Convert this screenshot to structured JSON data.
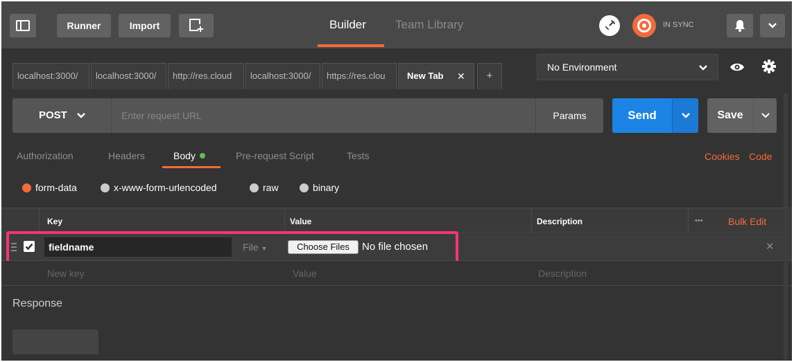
{
  "header": {
    "runner_label": "Runner",
    "import_label": "Import",
    "builder_label": "Builder",
    "team_library_label": "Team Library",
    "sync_label": "IN SYNC"
  },
  "tabs": [
    {
      "label": "localhost:3000/"
    },
    {
      "label": "localhost:3000/"
    },
    {
      "label": "http://res.cloud"
    },
    {
      "label": "localhost:3000/"
    },
    {
      "label": "https://res.clou"
    },
    {
      "label": "New Tab"
    }
  ],
  "environment": {
    "selected": "No Environment"
  },
  "request": {
    "method": "POST",
    "url_placeholder": "Enter request URL",
    "params_label": "Params",
    "send_label": "Send",
    "save_label": "Save"
  },
  "subtabs": {
    "authorization": "Authorization",
    "headers": "Headers",
    "body": "Body",
    "prerequest": "Pre-request Script",
    "tests": "Tests",
    "cookies": "Cookies",
    "code": "Code"
  },
  "body_modes": {
    "form_data": "form-data",
    "urlencoded": "x-www-form-urlencoded",
    "raw": "raw",
    "binary": "binary",
    "selected": "form-data"
  },
  "table": {
    "headers": {
      "key": "Key",
      "value": "Value",
      "description": "Description"
    },
    "more": "•••",
    "bulk_edit": "Bulk Edit",
    "row": {
      "key": "fieldname",
      "type": "File",
      "choose_files": "Choose Files",
      "file_status": "No file chosen",
      "checked": true
    },
    "placeholders": {
      "key": "New key",
      "value": "Value",
      "description": "Description"
    }
  },
  "response": {
    "label": "Response"
  },
  "colors": {
    "accent": "#f26b3a",
    "send": "#1c84e4",
    "highlight": "#f53671",
    "body_dot": "#5fc24c"
  }
}
